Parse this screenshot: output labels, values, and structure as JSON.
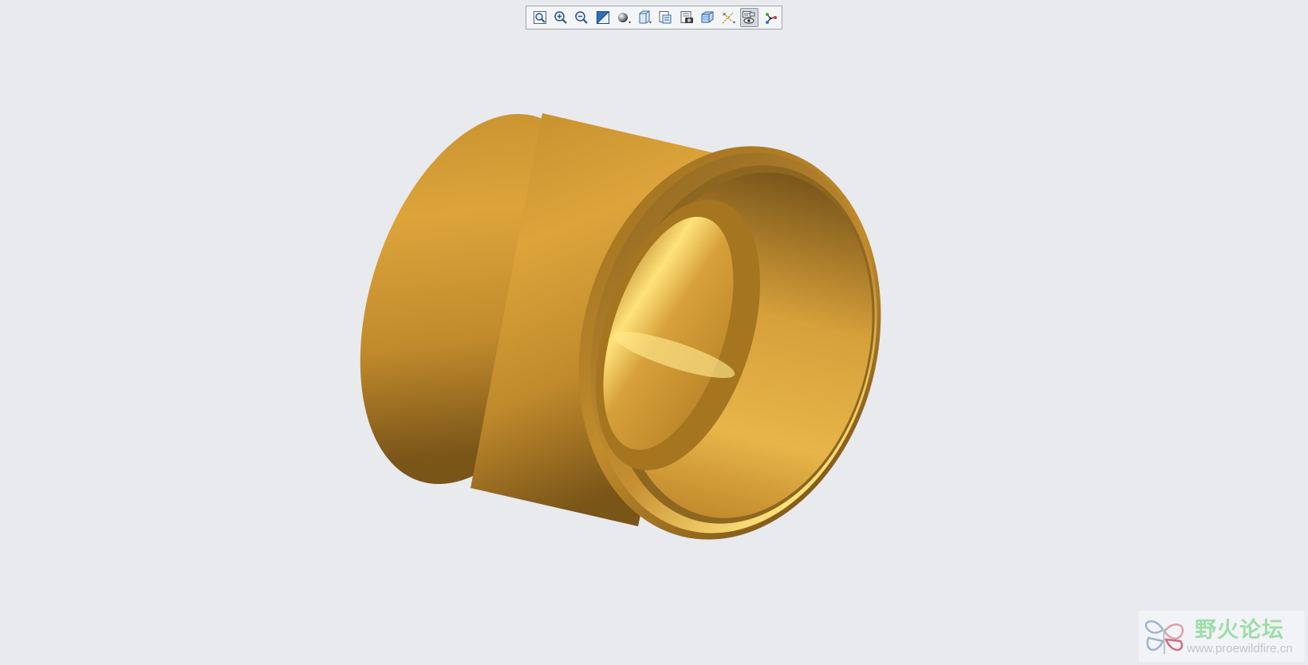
{
  "toolbar": {
    "buttons": [
      {
        "icon": "refit-icon",
        "active": false
      },
      {
        "icon": "zoom-in-icon",
        "active": false
      },
      {
        "icon": "zoom-out-icon",
        "active": false
      },
      {
        "icon": "repaint-icon",
        "active": false
      },
      {
        "icon": "display-style-icon",
        "active": false
      },
      {
        "icon": "saved-orientations-icon",
        "active": false
      },
      {
        "icon": "view-manager-icon",
        "active": false
      },
      {
        "icon": "perspective-view-icon",
        "active": false
      },
      {
        "icon": "section-view-icon",
        "active": false
      },
      {
        "icon": "datum-display-icon",
        "active": false
      },
      {
        "icon": "annotation-display-icon",
        "active": true
      },
      {
        "icon": "spin-center-icon",
        "active": false
      }
    ]
  },
  "model": {
    "name": "bushing-3d-model",
    "color": "#d9a23a"
  },
  "watermark": {
    "title": "野火论坛",
    "url": "www.proewildfire.cn"
  }
}
